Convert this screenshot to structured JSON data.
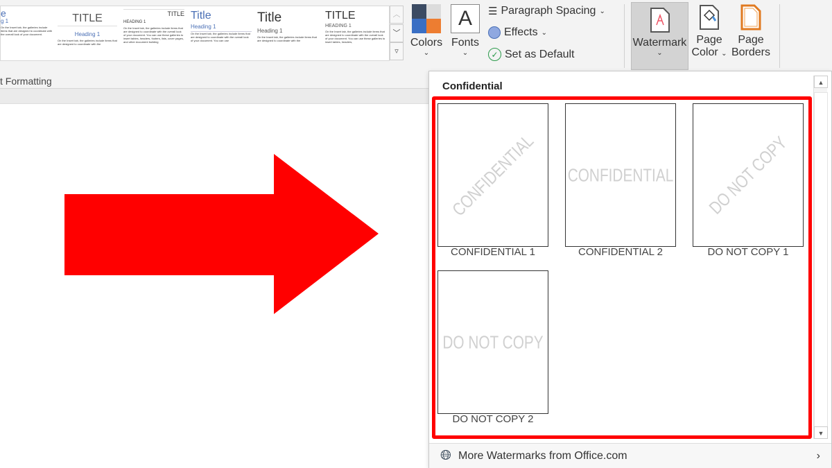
{
  "ribbon": {
    "styles": [
      {
        "title": "e",
        "heading": "g 1",
        "body": "On the Insert tab, the galleries include items that are designed to coordinate with the overall look of your document."
      },
      {
        "title": "TITLE",
        "heading": "Heading 1",
        "body": "On the Insert tab, the galleries include items that are designed to coordinate with the"
      },
      {
        "title": "TITLE",
        "heading": "HEADING 1",
        "body": "On the Insert tab, the galleries include items that are designed to coordinate with the overall look of your document. You can use these galleries to insert tables, headers, footers, lists, cover pages, and other document building"
      },
      {
        "title": "Title",
        "heading": "Heading 1",
        "body": "On the Insert tab, the galleries include items that are designed to coordinate with the overall look of your document. You can use"
      },
      {
        "title": "Title",
        "heading": "Heading 1",
        "body": "On the Insert tab, the galleries include items that are designed to coordinate with the"
      },
      {
        "title": "TITLE",
        "heading": "HEADING 1",
        "body": "On the Insert tab, the galleries include items that are designed to coordinate with the overall look of your document. You can use these galleries to insert tables, headers,"
      }
    ],
    "group_label": "t Formatting",
    "colors_label": "Colors",
    "fonts_label": "Fonts",
    "fonts_glyph": "A",
    "paragraph_spacing": "Paragraph Spacing",
    "effects": "Effects",
    "set_default": "Set as Default",
    "watermark": "Watermark",
    "page_color": [
      "Page",
      "Color"
    ],
    "page_borders": [
      "Page",
      "Borders"
    ],
    "accent": "#f00"
  },
  "panel": {
    "section": "Confidential",
    "items": [
      {
        "label": "CONFIDENTIAL 1",
        "watermark": "CONFIDENTIAL",
        "style": "diagonal"
      },
      {
        "label": "CONFIDENTIAL 2",
        "watermark": "CONFIDENTIAL",
        "style": "horizontal"
      },
      {
        "label": "DO NOT COPY 1",
        "watermark": "DO NOT COPY",
        "style": "diagonal"
      },
      {
        "label": "DO NOT COPY 2",
        "watermark": "DO NOT COPY",
        "style": "horizontal"
      }
    ],
    "footer": "More Watermarks from Office.com"
  }
}
